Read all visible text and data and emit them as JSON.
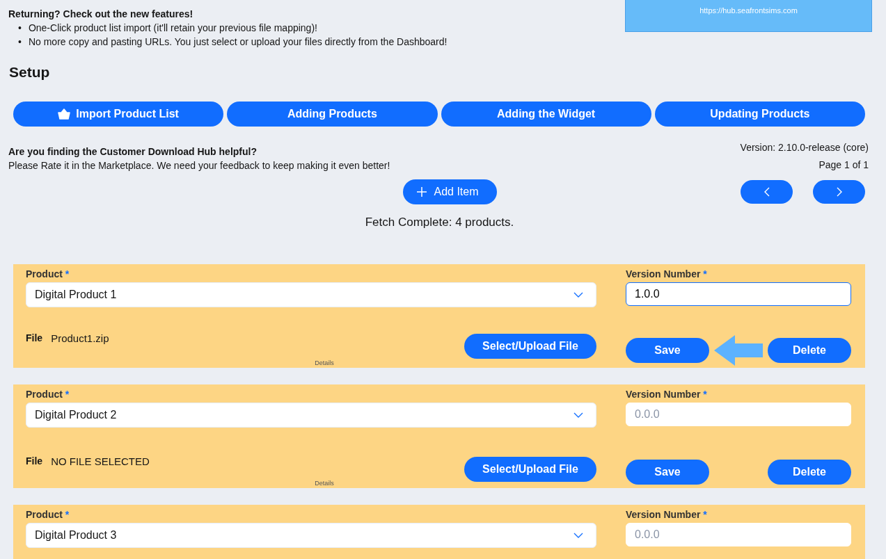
{
  "notice": {
    "title": "Returning? Check out the new features!",
    "bullets": [
      {
        "marker": "•",
        "text": "One-Click product list import (it'll retain your previous file mapping)!"
      },
      {
        "marker": "•",
        "text": "No more copy and pasting URLs. You just select or upload your files directly from the Dashboard!"
      }
    ]
  },
  "url_banner": "https://hub.seafrontsims.com",
  "setup": {
    "heading": "Setup",
    "tabs": [
      {
        "label": "Import Product List",
        "kind": "icon"
      },
      {
        "label": "Adding Products",
        "kind": "plain"
      },
      {
        "label": "Adding the Widget",
        "kind": "plain"
      },
      {
        "label": "Updating Products",
        "kind": "plain"
      }
    ]
  },
  "feedback": {
    "question": "Are you finding the Customer Download Hub helpful?",
    "request": "Please Rate it in the Marketplace. We need your feedback to keep making it even better!"
  },
  "version": "Version: 2.10.0-release (core)",
  "page": "Page 1 of 1",
  "add_button": "Add Item",
  "status": "Fetch Complete: 4 products.",
  "items": [
    {
      "product_label": "Product",
      "product_required": "*",
      "product": "Digital Product 1",
      "version_label": "Version Number",
      "version_required": "*",
      "version_value": "1.0.0",
      "focused": true,
      "file_label": "File",
      "file": "Product1.zip",
      "upload_button": "Select/Upload File",
      "save_button": "Save",
      "delete_button": "Delete",
      "details": "Details",
      "arrow": true
    },
    {
      "product_label": "Product",
      "product_required": "*",
      "product": "Digital Product 2",
      "version_label": "Version Number",
      "version_required": "*",
      "version_placeholder": "0.0.0",
      "focused": false,
      "file_label": "File",
      "file": "NO FILE SELECTED",
      "upload_button": "Select/Upload File",
      "save_button": "Save",
      "delete_button": "Delete",
      "details": "Details",
      "arrow": false
    },
    {
      "product_label": "Product",
      "product_required": "*",
      "product": "Digital Product 3",
      "version_label": "Version Number",
      "version_required": "*",
      "version_placeholder": "0.0.0",
      "focused": false,
      "arrow": false
    }
  ]
}
